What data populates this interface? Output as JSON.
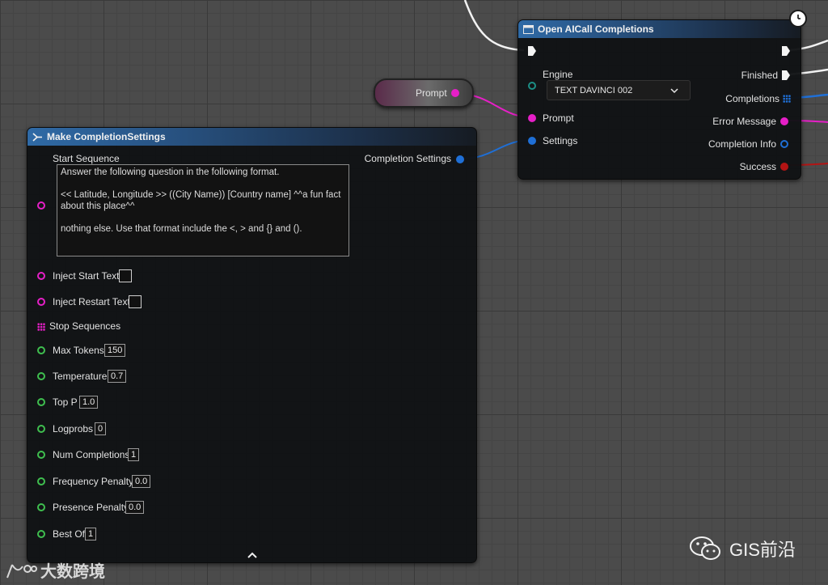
{
  "colors": {
    "string_pin": "#e61fc7",
    "numeric_pin": "#3fbf4f",
    "struct_pin": "#1f6fd6",
    "enum_pin": "#1c8f86",
    "bool_pin": "#b31414",
    "exec_pin": "#f4f4f4",
    "header_blue": "#2f6aa6"
  },
  "icons": {
    "make_node": "struct-make-icon",
    "open_node": "function-window-icon",
    "latent": "clock-icon",
    "expand": "chevron-up-icon"
  },
  "make_node": {
    "title": "Make CompletionSettings",
    "output_label": "Completion Settings",
    "start_sequence": {
      "label": "Start Sequence",
      "value": "Answer the following question in the following format.\n\n<< Latitude, Longitude >> ((City Name)) [Country name] ^^a fun fact about this place^^\n\nnothing else. Use that format include the <, > and {} and ()."
    },
    "inject_start_text": {
      "label": "Inject Start Text",
      "checked": false
    },
    "inject_restart_text": {
      "label": "Inject Restart Text",
      "checked": false
    },
    "stop_sequences": {
      "label": "Stop Sequences"
    },
    "max_tokens": {
      "label": "Max Tokens",
      "value": "150"
    },
    "temperature": {
      "label": "Temperature",
      "value": "0.7"
    },
    "top_p": {
      "label": "Top P",
      "value": "1.0"
    },
    "logprobs": {
      "label": "Logprobs",
      "value": "0"
    },
    "num_completions": {
      "label": "Num Completions",
      "value": "1"
    },
    "frequency_penalty": {
      "label": "Frequency Penalty",
      "value": "0.0"
    },
    "presence_penalty": {
      "label": "Presence Penalty",
      "value": "0.0"
    },
    "best_of": {
      "label": "Best Of",
      "value": "1"
    }
  },
  "open_node": {
    "title": "Open AICall Completions",
    "engine": {
      "label": "Engine",
      "selected": "TEXT DAVINCI 002"
    },
    "prompt_label": "Prompt",
    "settings_label": "Settings",
    "finished_label": "Finished",
    "completions_label": "Completions",
    "error_label": "Error Message",
    "info_label": "Completion Info",
    "success_label": "Success"
  },
  "prompt_var": {
    "label": "Prompt"
  },
  "watermarks": {
    "left": "大数跨境",
    "right": "GIS前沿"
  }
}
